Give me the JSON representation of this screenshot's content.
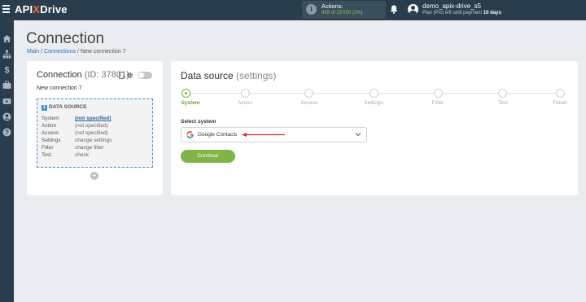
{
  "header": {
    "logo_pre": "API",
    "logo_x": "X",
    "logo_post": "Drive",
    "actions_label": "Actions:",
    "actions_used": "429",
    "actions_total": "of 25'000",
    "actions_percent": "(2%)",
    "user_name": "demo_apix-drive_s5",
    "plan_text": "Plan |Pro| left until payment",
    "plan_days": "10 days"
  },
  "sidebar": {
    "icons": [
      "home-icon",
      "sitemap-icon",
      "dollar-icon",
      "briefcase-icon",
      "video-icon",
      "user-icon",
      "help-icon"
    ]
  },
  "page": {
    "title": "Connection",
    "breadcrumb": {
      "main": "Main",
      "connections": "Connections",
      "current": "New connection 7",
      "separator": "/"
    }
  },
  "connection_card": {
    "title": "Connection",
    "id_text": "(ID: 37801)",
    "name": "New connection 7",
    "source": {
      "number": "1",
      "heading": "DATA SOURCE",
      "rows": [
        {
          "key": "System",
          "value": "(not specified)"
        },
        {
          "key": "Action",
          "value": "(not specified)"
        },
        {
          "key": "Access",
          "value": "(not specified)"
        },
        {
          "key": "Settings",
          "value": "change settings"
        },
        {
          "key": "Filter",
          "value": "change filter"
        },
        {
          "key": "Test",
          "value": "check"
        }
      ]
    },
    "add_symbol": "+"
  },
  "settings_card": {
    "title": "Data source",
    "subtitle": "(settings)",
    "steps": [
      "System",
      "Action",
      "Access",
      "Settings",
      "Filter",
      "Test",
      "Finish"
    ],
    "active_step": 0,
    "select_label": "Select system",
    "selected_system": "Google Contacts",
    "continue_label": "Continue"
  },
  "colors": {
    "topbar": "#2a3d4c",
    "accent_green": "#7fb647",
    "link_blue": "#2d6fb7",
    "annotation_red": "#d9302c"
  }
}
